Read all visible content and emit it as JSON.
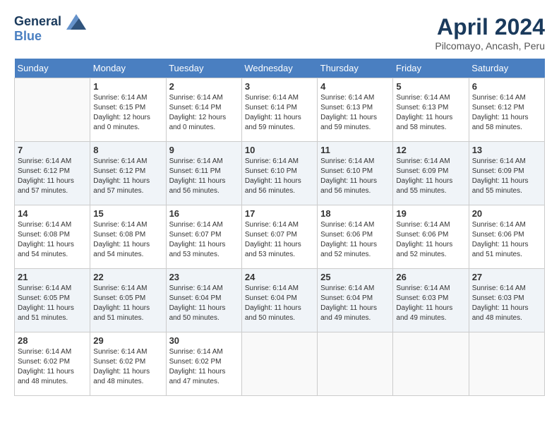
{
  "logo": {
    "line1": "General",
    "line2": "Blue"
  },
  "title": "April 2024",
  "location": "Pilcomayo, Ancash, Peru",
  "days_of_week": [
    "Sunday",
    "Monday",
    "Tuesday",
    "Wednesday",
    "Thursday",
    "Friday",
    "Saturday"
  ],
  "weeks": [
    [
      {
        "day": "",
        "sunrise": "",
        "sunset": "",
        "daylight": ""
      },
      {
        "day": "1",
        "sunrise": "6:14 AM",
        "sunset": "6:15 PM",
        "daylight": "12 hours and 0 minutes."
      },
      {
        "day": "2",
        "sunrise": "6:14 AM",
        "sunset": "6:14 PM",
        "daylight": "12 hours and 0 minutes."
      },
      {
        "day": "3",
        "sunrise": "6:14 AM",
        "sunset": "6:14 PM",
        "daylight": "11 hours and 59 minutes."
      },
      {
        "day": "4",
        "sunrise": "6:14 AM",
        "sunset": "6:13 PM",
        "daylight": "11 hours and 59 minutes."
      },
      {
        "day": "5",
        "sunrise": "6:14 AM",
        "sunset": "6:13 PM",
        "daylight": "11 hours and 58 minutes."
      },
      {
        "day": "6",
        "sunrise": "6:14 AM",
        "sunset": "6:12 PM",
        "daylight": "11 hours and 58 minutes."
      }
    ],
    [
      {
        "day": "7",
        "sunrise": "6:14 AM",
        "sunset": "6:12 PM",
        "daylight": "11 hours and 57 minutes."
      },
      {
        "day": "8",
        "sunrise": "6:14 AM",
        "sunset": "6:12 PM",
        "daylight": "11 hours and 57 minutes."
      },
      {
        "day": "9",
        "sunrise": "6:14 AM",
        "sunset": "6:11 PM",
        "daylight": "11 hours and 56 minutes."
      },
      {
        "day": "10",
        "sunrise": "6:14 AM",
        "sunset": "6:10 PM",
        "daylight": "11 hours and 56 minutes."
      },
      {
        "day": "11",
        "sunrise": "6:14 AM",
        "sunset": "6:10 PM",
        "daylight": "11 hours and 56 minutes."
      },
      {
        "day": "12",
        "sunrise": "6:14 AM",
        "sunset": "6:09 PM",
        "daylight": "11 hours and 55 minutes."
      },
      {
        "day": "13",
        "sunrise": "6:14 AM",
        "sunset": "6:09 PM",
        "daylight": "11 hours and 55 minutes."
      }
    ],
    [
      {
        "day": "14",
        "sunrise": "6:14 AM",
        "sunset": "6:08 PM",
        "daylight": "11 hours and 54 minutes."
      },
      {
        "day": "15",
        "sunrise": "6:14 AM",
        "sunset": "6:08 PM",
        "daylight": "11 hours and 54 minutes."
      },
      {
        "day": "16",
        "sunrise": "6:14 AM",
        "sunset": "6:07 PM",
        "daylight": "11 hours and 53 minutes."
      },
      {
        "day": "17",
        "sunrise": "6:14 AM",
        "sunset": "6:07 PM",
        "daylight": "11 hours and 53 minutes."
      },
      {
        "day": "18",
        "sunrise": "6:14 AM",
        "sunset": "6:06 PM",
        "daylight": "11 hours and 52 minutes."
      },
      {
        "day": "19",
        "sunrise": "6:14 AM",
        "sunset": "6:06 PM",
        "daylight": "11 hours and 52 minutes."
      },
      {
        "day": "20",
        "sunrise": "6:14 AM",
        "sunset": "6:06 PM",
        "daylight": "11 hours and 51 minutes."
      }
    ],
    [
      {
        "day": "21",
        "sunrise": "6:14 AM",
        "sunset": "6:05 PM",
        "daylight": "11 hours and 51 minutes."
      },
      {
        "day": "22",
        "sunrise": "6:14 AM",
        "sunset": "6:05 PM",
        "daylight": "11 hours and 51 minutes."
      },
      {
        "day": "23",
        "sunrise": "6:14 AM",
        "sunset": "6:04 PM",
        "daylight": "11 hours and 50 minutes."
      },
      {
        "day": "24",
        "sunrise": "6:14 AM",
        "sunset": "6:04 PM",
        "daylight": "11 hours and 50 minutes."
      },
      {
        "day": "25",
        "sunrise": "6:14 AM",
        "sunset": "6:04 PM",
        "daylight": "11 hours and 49 minutes."
      },
      {
        "day": "26",
        "sunrise": "6:14 AM",
        "sunset": "6:03 PM",
        "daylight": "11 hours and 49 minutes."
      },
      {
        "day": "27",
        "sunrise": "6:14 AM",
        "sunset": "6:03 PM",
        "daylight": "11 hours and 48 minutes."
      }
    ],
    [
      {
        "day": "28",
        "sunrise": "6:14 AM",
        "sunset": "6:02 PM",
        "daylight": "11 hours and 48 minutes."
      },
      {
        "day": "29",
        "sunrise": "6:14 AM",
        "sunset": "6:02 PM",
        "daylight": "11 hours and 48 minutes."
      },
      {
        "day": "30",
        "sunrise": "6:14 AM",
        "sunset": "6:02 PM",
        "daylight": "11 hours and 47 minutes."
      },
      {
        "day": "",
        "sunrise": "",
        "sunset": "",
        "daylight": ""
      },
      {
        "day": "",
        "sunrise": "",
        "sunset": "",
        "daylight": ""
      },
      {
        "day": "",
        "sunrise": "",
        "sunset": "",
        "daylight": ""
      },
      {
        "day": "",
        "sunrise": "",
        "sunset": "",
        "daylight": ""
      }
    ]
  ]
}
